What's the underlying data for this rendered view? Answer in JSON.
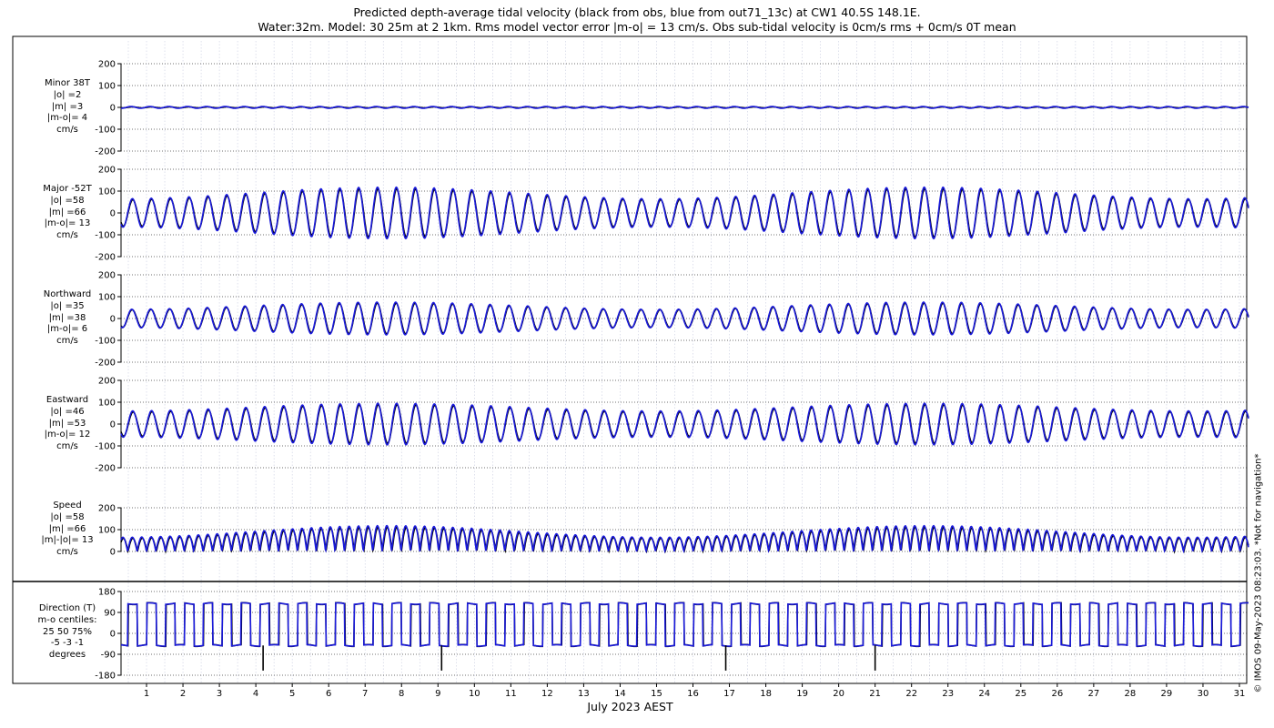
{
  "figure": {
    "title_line1": "Predicted depth-average tidal velocity (black from obs, blue from out71_13c) at CW1 40.5S 148.1E.",
    "title_line2": "Water:32m. Model: 30 25m at 2 1km. Rms model vector error |m-o| = 13 cm/s. Obs sub-tidal velocity is 0cm/s rms + 0cm/s 0T mean",
    "xlabel": "July 2023 AEST",
    "footer": "© IMOS 09-May-2023 08:23:03. *Not for navigation*",
    "obs_color": "#000000",
    "model_color": "#1a1adc"
  },
  "chart_data": [
    {
      "type": "line",
      "panel": "minor",
      "label_lines": [
        "Minor 38T",
        "|o| =2",
        "|m| =3",
        "|m-o|= 4",
        "cm/s"
      ],
      "ylim": [
        -200,
        200
      ],
      "yticks": [
        -200,
        -100,
        0,
        100,
        200
      ],
      "xlim": [
        0.3,
        31.25
      ],
      "series": [
        {
          "amplitude": 2
        },
        {
          "amplitude": 4
        }
      ],
      "annotations_peak_days": [
        6.9,
        8.0,
        8.9,
        21.0,
        22.0
      ]
    },
    {
      "type": "line",
      "panel": "major",
      "label_lines": [
        "Major -52T",
        "|o| =58",
        "|m| =66",
        "|m-o|= 13",
        "cm/s"
      ],
      "ylim": [
        -200,
        200
      ],
      "yticks": [
        -200,
        -100,
        0,
        100,
        200
      ],
      "xlim": [
        0.3,
        31.25
      ],
      "series": [
        {
          "amplitude_range": [
            60,
            110
          ]
        },
        {
          "amplitude_range": [
            65,
            118
          ]
        }
      ]
    },
    {
      "type": "line",
      "panel": "northward",
      "label_lines": [
        "Northward",
        "|o| =35",
        "|m| =38",
        "|m-o|= 6",
        "cm/s"
      ],
      "ylim": [
        -200,
        200
      ],
      "yticks": [
        -200,
        -100,
        0,
        100,
        200
      ],
      "xlim": [
        0.3,
        31.25
      ],
      "series": [
        {
          "amplitude_range": [
            40,
            70
          ]
        },
        {
          "amplitude_range": [
            42,
            75
          ]
        }
      ]
    },
    {
      "type": "line",
      "panel": "eastward",
      "label_lines": [
        "Eastward",
        "|o| =46",
        "|m| =53",
        "|m-o|= 12",
        "cm/s"
      ],
      "ylim": [
        -200,
        200
      ],
      "yticks": [
        -200,
        -100,
        0,
        100,
        200
      ],
      "xlim": [
        0.3,
        31.25
      ],
      "series": [
        {
          "amplitude_range": [
            55,
            88
          ]
        },
        {
          "amplitude_range": [
            60,
            95
          ]
        }
      ]
    },
    {
      "type": "line",
      "panel": "speed",
      "label_lines": [
        "Speed",
        "|o| =58",
        "|m| =66",
        "|m|-|o|= 13",
        "cm/s"
      ],
      "ylim": [
        0,
        200
      ],
      "yticks": [
        0,
        100,
        200
      ],
      "xlim": [
        0.3,
        31.25
      ],
      "series": [
        {
          "amplitude_range": [
            60,
            110
          ]
        },
        {
          "amplitude_range": [
            65,
            118
          ]
        }
      ]
    },
    {
      "type": "line",
      "panel": "direction",
      "label_lines": [
        "Direction (T)",
        "m-o centiles:",
        "25  50  75%",
        "-5 -3 -1",
        "degrees"
      ],
      "ylim": [
        -180,
        180
      ],
      "yticks": [
        -180,
        -90,
        0,
        90,
        180
      ],
      "xlim": [
        0.3,
        31.25
      ],
      "series": [
        {
          "levels": [
            128,
            -52
          ]
        },
        {
          "levels": [
            128,
            -52
          ]
        }
      ],
      "spike_days": [
        4.2,
        9.1,
        16.9,
        21.0
      ]
    }
  ],
  "xaxis": {
    "ticks": [
      "1",
      "2",
      "3",
      "4",
      "5",
      "6",
      "7",
      "8",
      "9",
      "10",
      "11",
      "12",
      "13",
      "14",
      "15",
      "16",
      "17",
      "18",
      "19",
      "20",
      "21",
      "22",
      "23",
      "24",
      "25",
      "26",
      "27",
      "28",
      "29",
      "30",
      "31"
    ]
  }
}
